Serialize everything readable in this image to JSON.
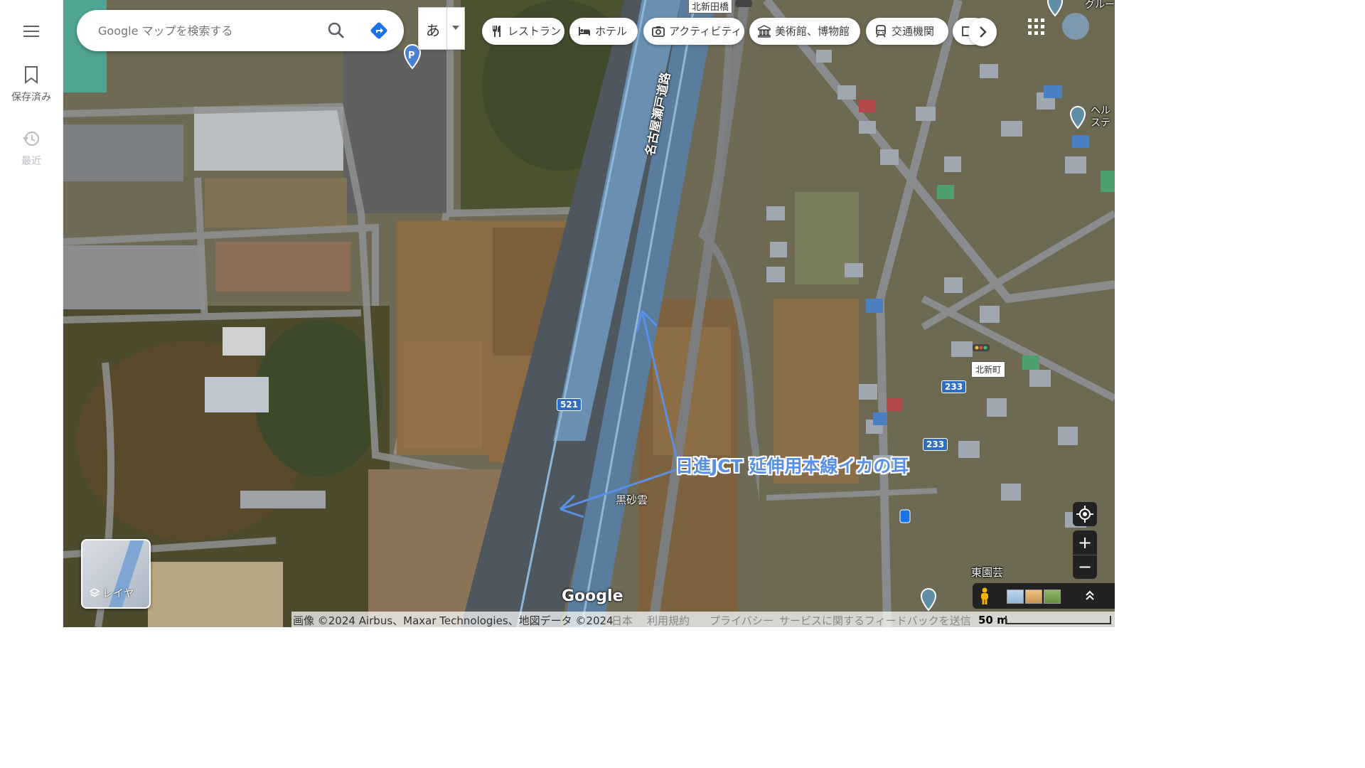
{
  "rail": {
    "saved_label": "保存済み",
    "recent_label": "最近"
  },
  "search": {
    "placeholder": "Google マップを検索する"
  },
  "ime": {
    "char": "あ"
  },
  "chips": [
    {
      "label": "レストラン",
      "icon": "fork-knife-icon"
    },
    {
      "label": "ホテル",
      "icon": "bed-icon"
    },
    {
      "label": "アクティビティ",
      "icon": "camera-icon"
    },
    {
      "label": "美術館、博物館",
      "icon": "museum-icon"
    },
    {
      "label": "交通機関",
      "icon": "train-icon"
    }
  ],
  "map": {
    "place_labels": {
      "kitashinda_bridge": "北新田橋",
      "kitashin_machi": "北新町",
      "higashi_engei": "東園芸",
      "kurosagumo": "黒砂雲",
      "group_home": "グループ",
      "health_station": "ヘル\nステ"
    },
    "road_name": "名古屋瀬戸道路",
    "route_shields": [
      "521",
      "233",
      "233"
    ],
    "annotation": "日進JCT 延伸用本線イカの耳",
    "annotation_color": "#5a8fe6"
  },
  "layer": {
    "label": "レイヤ"
  },
  "controls": {
    "zoom_in": "+",
    "zoom_out": "−"
  },
  "footer": {
    "imagery": "画像 ©2024 Airbus、Maxar Technologies、地図データ ©2024",
    "country": "日本",
    "terms": "利用規約",
    "privacy": "プライバシー",
    "feedback": "サービスに関するフィードバックを送信",
    "scale": "50 m"
  },
  "brand": {
    "google": "Google"
  }
}
